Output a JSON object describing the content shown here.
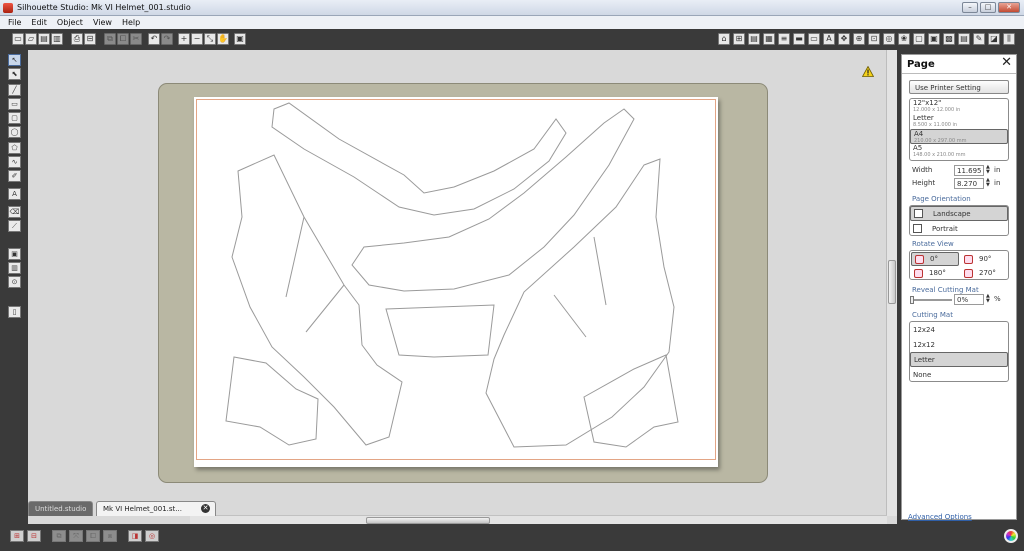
{
  "window": {
    "title": "Silhouette Studio: Mk VI Helmet_001.studio",
    "min_glyph": "–",
    "max_glyph": "□",
    "close_glyph": "✕"
  },
  "menu": [
    "File",
    "Edit",
    "Object",
    "View",
    "Help"
  ],
  "toolbar_left": [
    {
      "icon": "new-file-icon",
      "glyph": "▭"
    },
    {
      "icon": "open-file-icon",
      "glyph": "▱"
    },
    {
      "icon": "save-icon",
      "glyph": "▤"
    },
    {
      "icon": "save-as-icon",
      "glyph": "▥"
    },
    {
      "icon": "print-icon",
      "glyph": "⎙"
    },
    {
      "icon": "send-to-cutter-icon",
      "glyph": "⊟"
    },
    {
      "icon": "copy-icon",
      "glyph": "⧉"
    },
    {
      "icon": "paste-icon",
      "glyph": "⧠"
    },
    {
      "icon": "cut-icon",
      "glyph": "✂"
    },
    {
      "icon": "undo-icon",
      "glyph": "↶"
    },
    {
      "icon": "redo-icon",
      "glyph": "↷"
    },
    {
      "icon": "zoom-in-icon",
      "glyph": "+"
    },
    {
      "icon": "zoom-out-icon",
      "glyph": "−"
    },
    {
      "icon": "zoom-select-icon",
      "glyph": "⤡"
    },
    {
      "icon": "pan-hand-icon",
      "glyph": "✋"
    },
    {
      "icon": "fit-to-page-icon",
      "glyph": "▣"
    }
  ],
  "toolbar_right": [
    {
      "icon": "store-icon",
      "glyph": "⌂"
    },
    {
      "icon": "grid-icon",
      "glyph": "⊞"
    },
    {
      "icon": "page-setup-icon",
      "glyph": "▤"
    },
    {
      "icon": "cut-settings-icon",
      "glyph": "▦"
    },
    {
      "icon": "line-style-icon",
      "glyph": "≡"
    },
    {
      "icon": "fill-color-icon",
      "glyph": "▬"
    },
    {
      "icon": "line-color-icon",
      "glyph": "▭"
    },
    {
      "icon": "text-style-icon",
      "glyph": "A"
    },
    {
      "icon": "transform-icon",
      "glyph": "✥"
    },
    {
      "icon": "replicate-icon",
      "glyph": "⊕"
    },
    {
      "icon": "modify-icon",
      "glyph": "⊡"
    },
    {
      "icon": "offset-icon",
      "glyph": "◎"
    },
    {
      "icon": "trace-icon",
      "glyph": "❀"
    },
    {
      "icon": "library-icon",
      "glyph": "▢"
    },
    {
      "icon": "mat-preview-icon",
      "glyph": "▣"
    },
    {
      "icon": "show-library-icon",
      "glyph": "▩"
    },
    {
      "icon": "media-icon",
      "glyph": "▤"
    },
    {
      "icon": "sketch-icon",
      "glyph": "✎"
    },
    {
      "icon": "design-icon",
      "glyph": "◪"
    },
    {
      "icon": "send-icon",
      "glyph": "⫼"
    }
  ],
  "left_tools": [
    {
      "icon": "select-tool-icon",
      "glyph": "↖",
      "selected": true
    },
    {
      "icon": "point-edit-tool-icon",
      "glyph": "⬉"
    },
    {
      "icon": "line-tool-icon",
      "glyph": "╱"
    },
    {
      "icon": "rectangle-tool-icon",
      "glyph": "▭"
    },
    {
      "icon": "rounded-rectangle-tool-icon",
      "glyph": "▢"
    },
    {
      "icon": "ellipse-tool-icon",
      "glyph": "◯"
    },
    {
      "icon": "polygon-tool-icon",
      "glyph": "⬠"
    },
    {
      "icon": "curve-tool-icon",
      "glyph": "∿"
    },
    {
      "icon": "freehand-tool-icon",
      "glyph": "✐"
    },
    {
      "icon": "text-tool-icon",
      "glyph": "A"
    },
    {
      "icon": "eraser-tool-icon",
      "glyph": "⌫"
    },
    {
      "icon": "knife-tool-icon",
      "glyph": "⟋"
    },
    {
      "icon": "fill-panel-icon",
      "glyph": "▣"
    },
    {
      "icon": "layers-panel-icon",
      "glyph": "▥"
    },
    {
      "icon": "registration-icon",
      "glyph": "⊙"
    },
    {
      "icon": "library-panel-icon",
      "glyph": "▯"
    }
  ],
  "tabs": {
    "inactive": "Untitled.studio",
    "active": "Mk VI Helmet_001.st...",
    "close_glyph": "✕"
  },
  "bottom_tools": [
    {
      "icon": "group-icon",
      "glyph": "⊞"
    },
    {
      "icon": "ungroup-icon",
      "glyph": "⊟"
    },
    {
      "icon": "compound-path-icon",
      "glyph": "⧉"
    },
    {
      "icon": "release-compound-icon",
      "glyph": "⤧"
    },
    {
      "icon": "weld-icon",
      "glyph": "⧠"
    },
    {
      "icon": "subtract-icon",
      "glyph": "⧈"
    },
    {
      "icon": "bring-to-front-icon",
      "glyph": "◨"
    },
    {
      "icon": "send-to-back-icon",
      "glyph": "◎"
    }
  ],
  "panel": {
    "title": "Page",
    "close_glyph": "✕",
    "printer_button": "Use Printer Setting",
    "paper_sizes": [
      {
        "name": "12\"x12\"",
        "dims": "12.000 x 12.000 in",
        "selected": false
      },
      {
        "name": "Letter",
        "dims": "8.500 x 11.000 in",
        "selected": false
      },
      {
        "name": "A4",
        "dims": "210.00 x 297.00 mm",
        "selected": true
      },
      {
        "name": "A5",
        "dims": "148.00 x 210.00 mm",
        "selected": false
      }
    ],
    "width_label": "Width",
    "width_value": "11.695",
    "height_label": "Height",
    "height_value": "8.270",
    "unit": "in",
    "orientation_label": "Page Orientation",
    "orientations": [
      {
        "label": "Landscape",
        "selected": true
      },
      {
        "label": "Portrait",
        "selected": false
      }
    ],
    "rotate_label": "Rotate View",
    "rotations": [
      {
        "label": "0°",
        "selected": true
      },
      {
        "label": "90°",
        "selected": false
      },
      {
        "label": "180°",
        "selected": false
      },
      {
        "label": "270°",
        "selected": false
      }
    ],
    "reveal_label": "Reveal Cutting Mat",
    "reveal_value": "0%",
    "reveal_unit": "%",
    "reveal_level": 0,
    "mat_label": "Cutting Mat",
    "mats": [
      {
        "label": "12x24",
        "selected": false
      },
      {
        "label": "12x12",
        "selected": false
      },
      {
        "label": "Letter",
        "selected": true
      },
      {
        "label": "None",
        "selected": false
      }
    ],
    "advanced": "Advanced Options"
  },
  "colors": {
    "chrome_dark": "#3a3a3a",
    "mat": "#b9b7a3",
    "cut_margin": "#e3a585",
    "shape_stroke": "#9a9a9a",
    "accent": "#4a6b9c"
  }
}
